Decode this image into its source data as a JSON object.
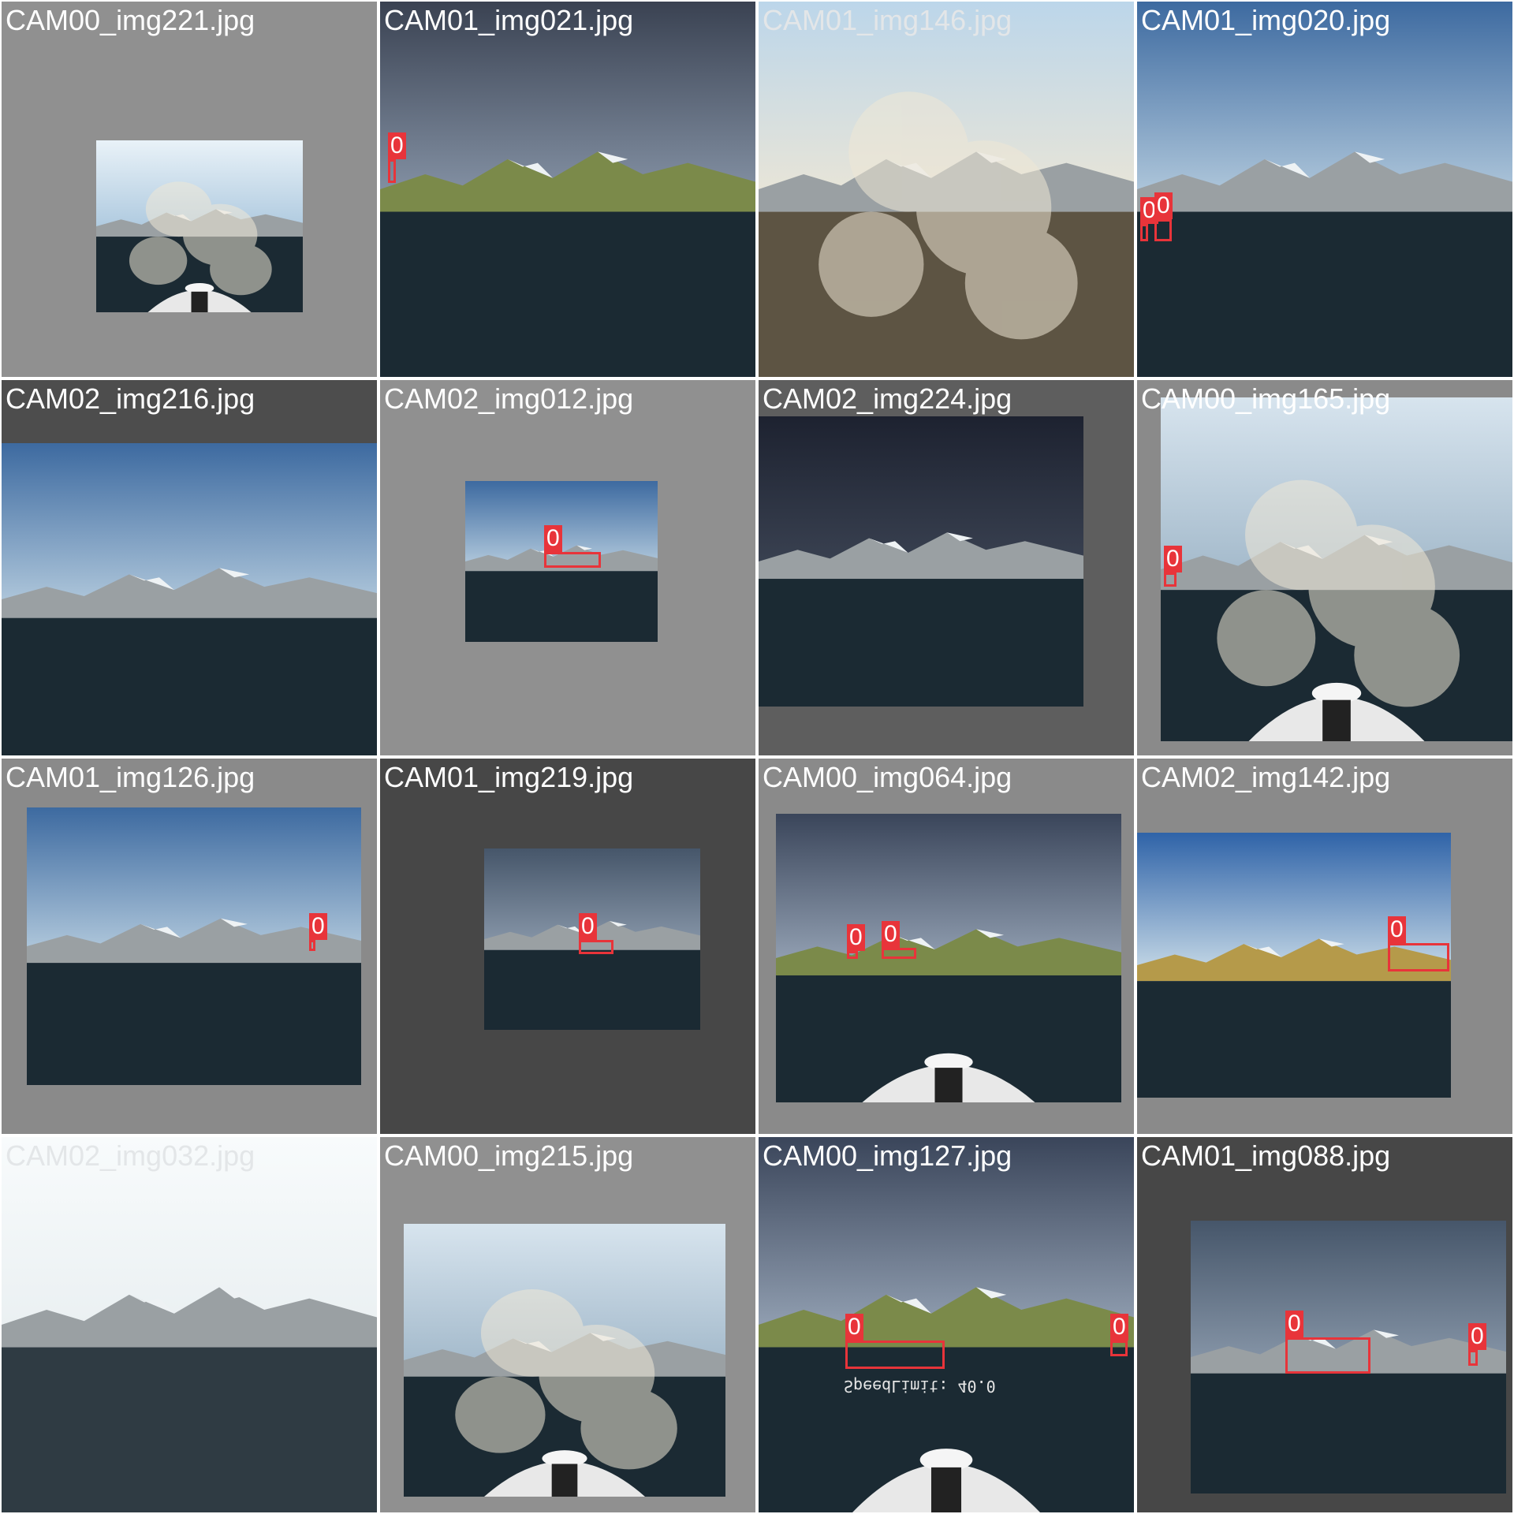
{
  "colors": {
    "detection": "#e8343a",
    "caption": "#ffffff"
  },
  "tiles": [
    {
      "filename": "CAM00_img221.jpg",
      "bg": "#909090",
      "photo": {
        "l": 120,
        "t": 176,
        "w": 262,
        "h": 218
      },
      "scene": "steam",
      "labels": []
    },
    {
      "filename": "CAM01_img021.jpg",
      "bg": "#1c1f24",
      "photo": {
        "l": 0,
        "t": 0,
        "w": 476,
        "h": 476
      },
      "scene": "storm",
      "labels": [
        {
          "text": "0",
          "l": 10,
          "t": 200,
          "w": 10,
          "h": 30
        }
      ]
    },
    {
      "filename": "CAM01_img146.jpg",
      "bg": "#d9d4c8",
      "photo": {
        "l": 0,
        "t": 0,
        "w": 476,
        "h": 476
      },
      "scene": "smoke",
      "labels": []
    },
    {
      "filename": "CAM01_img020.jpg",
      "bg": "#2a3a52",
      "photo": {
        "l": 0,
        "t": 0,
        "w": 476,
        "h": 476
      },
      "scene": "clear",
      "labels": [
        {
          "text": "0",
          "l": 4,
          "t": 282,
          "w": 10,
          "h": 22
        },
        {
          "text": "0",
          "l": 22,
          "t": 276,
          "w": 22,
          "h": 28
        }
      ]
    },
    {
      "filename": "CAM02_img216.jpg",
      "bg": "#4d4d4d",
      "photo": {
        "l": 0,
        "t": 80,
        "w": 476,
        "h": 396
      },
      "scene": "clear",
      "labels": []
    },
    {
      "filename": "CAM02_img012.jpg",
      "bg": "#909090",
      "photo": {
        "l": 108,
        "t": 128,
        "w": 244,
        "h": 204
      },
      "scene": "clear",
      "labels": [
        {
          "text": "0",
          "l": 208,
          "t": 218,
          "w": 72,
          "h": 20
        }
      ]
    },
    {
      "filename": "CAM02_img224.jpg",
      "bg": "#5e5e5e",
      "photo": {
        "l": 0,
        "t": 46,
        "w": 412,
        "h": 368
      },
      "scene": "dark",
      "labels": []
    },
    {
      "filename": "CAM00_img165.jpg",
      "bg": "#8a8a8a",
      "photo": {
        "l": 30,
        "t": 22,
        "w": 446,
        "h": 436
      },
      "scene": "steam-boat",
      "labels": [
        {
          "text": "0",
          "l": 34,
          "t": 244,
          "w": 16,
          "h": 18
        }
      ]
    },
    {
      "filename": "CAM01_img126.jpg",
      "bg": "#8a8a8a",
      "photo": {
        "l": 32,
        "t": 62,
        "w": 424,
        "h": 352
      },
      "scene": "clear",
      "labels": [
        {
          "text": "0",
          "l": 390,
          "t": 230,
          "w": 8,
          "h": 14
        }
      ]
    },
    {
      "filename": "CAM01_img219.jpg",
      "bg": "#474747",
      "photo": {
        "l": 132,
        "t": 114,
        "w": 274,
        "h": 230
      },
      "scene": "dusk",
      "labels": [
        {
          "text": "0",
          "l": 252,
          "t": 230,
          "w": 44,
          "h": 18
        }
      ]
    },
    {
      "filename": "CAM00_img064.jpg",
      "bg": "#8a8a8a",
      "photo": {
        "l": 22,
        "t": 70,
        "w": 438,
        "h": 366
      },
      "scene": "storm-boat",
      "labels": [
        {
          "text": "0",
          "l": 112,
          "t": 244,
          "w": 14,
          "h": 10
        },
        {
          "text": "0",
          "l": 156,
          "t": 240,
          "w": 44,
          "h": 14
        }
      ]
    },
    {
      "filename": "CAM02_img142.jpg",
      "bg": "#8a8a8a",
      "photo": {
        "l": 0,
        "t": 94,
        "w": 398,
        "h": 336
      },
      "scene": "clear-ship",
      "labels": [
        {
          "text": "0",
          "l": 318,
          "t": 234,
          "w": 78,
          "h": 36
        }
      ]
    },
    {
      "filename": "CAM02_img032.jpg",
      "bg": "#f4f7f8",
      "photo": {
        "l": 0,
        "t": 0,
        "w": 476,
        "h": 476
      },
      "scene": "bright",
      "labels": []
    },
    {
      "filename": "CAM00_img215.jpg",
      "bg": "#909090",
      "photo": {
        "l": 30,
        "t": 110,
        "w": 408,
        "h": 346
      },
      "scene": "steam-boat",
      "labels": []
    },
    {
      "filename": "CAM00_img127.jpg",
      "bg": "#2f3d55",
      "photo": {
        "l": 0,
        "t": 0,
        "w": 476,
        "h": 476
      },
      "scene": "storm-boat",
      "labels": [
        {
          "text": "0",
          "l": 110,
          "t": 258,
          "w": 126,
          "h": 36
        },
        {
          "text": "0",
          "l": 446,
          "t": 258,
          "w": 22,
          "h": 20
        }
      ],
      "overlay": "SpeedLimit: 40.0"
    },
    {
      "filename": "CAM01_img088.jpg",
      "bg": "#474747",
      "photo": {
        "l": 68,
        "t": 106,
        "w": 400,
        "h": 346
      },
      "scene": "dusk",
      "labels": [
        {
          "text": "0",
          "l": 188,
          "t": 254,
          "w": 108,
          "h": 46
        },
        {
          "text": "0",
          "l": 420,
          "t": 270,
          "w": 12,
          "h": 20
        }
      ]
    }
  ]
}
